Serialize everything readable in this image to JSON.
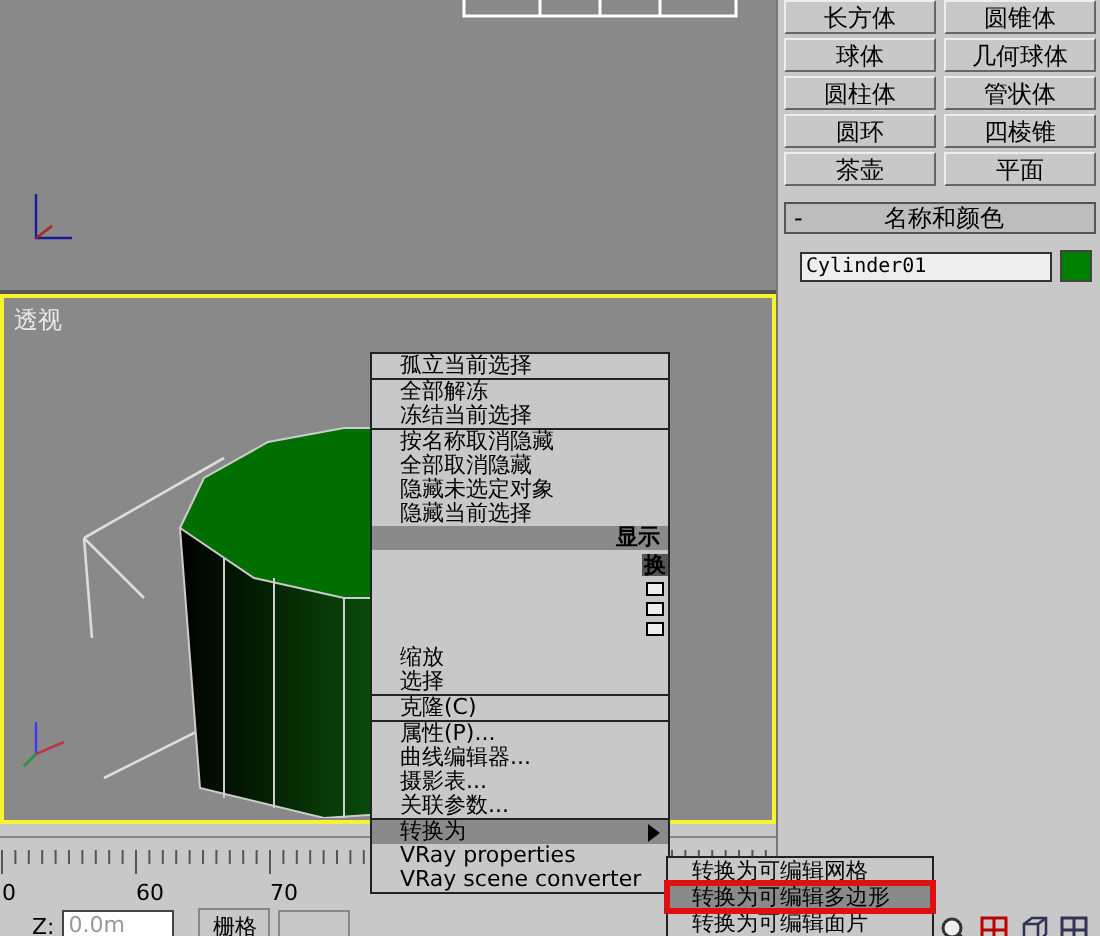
{
  "perspective_viewport": {
    "label": "透视",
    "active": true
  },
  "context_menu": {
    "upper_groups": [
      [
        {
          "label": "孤立当前选择",
          "selected": false,
          "submenu": false
        }
      ],
      [
        {
          "label": "全部解冻",
          "selected": false,
          "submenu": false
        },
        {
          "label": "冻结当前选择",
          "selected": false,
          "submenu": false
        }
      ],
      [
        {
          "label": "按名称取消隐藏",
          "selected": false,
          "submenu": false
        },
        {
          "label": "全部取消隐藏",
          "selected": false,
          "submenu": false
        },
        {
          "label": "隐藏未选定对象",
          "selected": false,
          "submenu": false
        },
        {
          "label": "隐藏当前选择",
          "selected": false,
          "submenu": false
        }
      ]
    ],
    "upper_header": "显示",
    "lower_header": "换",
    "lower_groups": [
      [
        {
          "label": "缩放",
          "selected": false,
          "submenu": false
        },
        {
          "label": "选择",
          "selected": false,
          "submenu": false
        }
      ],
      [
        {
          "label": "克隆(C)",
          "selected": false,
          "submenu": false
        }
      ],
      [
        {
          "label": "属性(P)...",
          "selected": false,
          "submenu": false
        },
        {
          "label": "曲线编辑器...",
          "selected": false,
          "submenu": false
        },
        {
          "label": "摄影表...",
          "selected": false,
          "submenu": false
        },
        {
          "label": "关联参数...",
          "selected": false,
          "submenu": false
        }
      ],
      [
        {
          "label": "转换为",
          "selected": true,
          "submenu": true
        },
        {
          "label": "VRay properties",
          "selected": false,
          "submenu": false
        },
        {
          "label": "VRay scene converter",
          "selected": false,
          "submenu": false
        }
      ]
    ]
  },
  "submenu": {
    "items": [
      {
        "label": "转换为可编辑网格",
        "selected": false
      },
      {
        "label": "转换为可编辑多边形",
        "selected": true
      },
      {
        "label": "转换为可编辑面片",
        "selected": false
      }
    ]
  },
  "create_panel": {
    "buttons": [
      "长方体",
      "圆锥体",
      "球体",
      "几何球体",
      "圆柱体",
      "管状体",
      "圆环",
      "四棱锥",
      "茶壶",
      "平面"
    ],
    "rollout": {
      "toggle": "-",
      "title": "名称和颜色"
    },
    "name_field": {
      "value": "Cylinder01"
    },
    "object_color": {
      "color": "#008000"
    }
  },
  "timeline": {
    "labels": [
      "0",
      "60",
      "70"
    ]
  },
  "status_bar": {
    "coord_label": "Z:",
    "coord_value": "0.0m",
    "grid_button": "栅格"
  }
}
